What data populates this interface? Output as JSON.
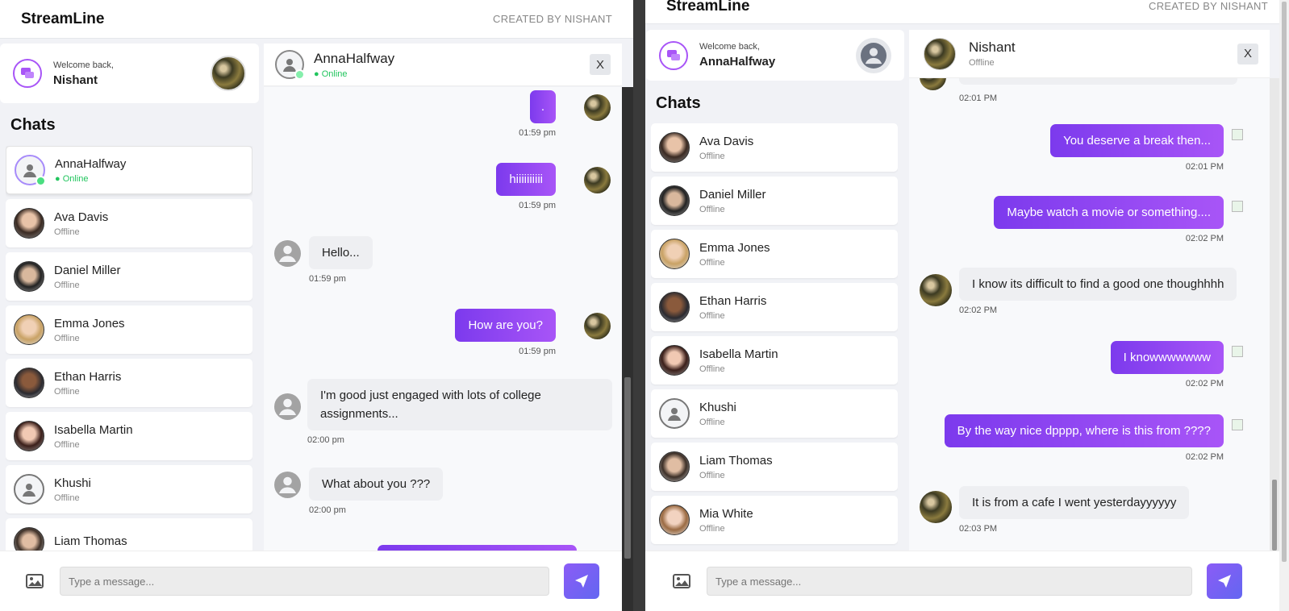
{
  "left": {
    "brand": "StreamLine",
    "credit": "CREATED BY NISHANT",
    "welcome": {
      "greeting": "Welcome back,",
      "name": "Nishant"
    },
    "chats_title": "Chats",
    "contacts": [
      {
        "name": "AnnaHalfway",
        "status": "● Online"
      },
      {
        "name": "Ava Davis",
        "status": "Offline"
      },
      {
        "name": "Daniel Miller",
        "status": "Offline"
      },
      {
        "name": "Emma Jones",
        "status": "Offline"
      },
      {
        "name": "Ethan Harris",
        "status": "Offline"
      },
      {
        "name": "Isabella Martin",
        "status": "Offline"
      },
      {
        "name": "Khushi",
        "status": "Offline"
      },
      {
        "name": "Liam Thomas",
        "status": ""
      }
    ],
    "header": {
      "name": "AnnaHalfway",
      "status": "● Online",
      "close": "X"
    },
    "messages": [
      {
        "text": ".",
        "time": "01:59 pm"
      },
      {
        "text": "hiiiiiiiiii",
        "time": "01:59 pm"
      },
      {
        "text": "Hello...",
        "time": "01:59 pm"
      },
      {
        "text": "How are you?",
        "time": "01:59 pm"
      },
      {
        "text": "I'm good just engaged with lots of college assignments...",
        "time": "02:00 pm"
      },
      {
        "text": "What about you ???",
        "time": "02:00 pm"
      }
    ],
    "input_placeholder": "Type a message..."
  },
  "right": {
    "brand": "StreamLine",
    "credit": "CREATED BY NISHANT",
    "welcome": {
      "greeting": "Welcome back,",
      "name": "AnnaHalfway"
    },
    "chats_title": "Chats",
    "contacts": [
      {
        "name": "Ava Davis",
        "status": "Offline"
      },
      {
        "name": "Daniel Miller",
        "status": "Offline"
      },
      {
        "name": "Emma Jones",
        "status": "Offline"
      },
      {
        "name": "Ethan Harris",
        "status": "Offline"
      },
      {
        "name": "Isabella Martin",
        "status": "Offline"
      },
      {
        "name": "Khushi",
        "status": "Offline"
      },
      {
        "name": "Liam Thomas",
        "status": "Offline"
      },
      {
        "name": "Mia White",
        "status": "Offline"
      }
    ],
    "header": {
      "name": "Nishant",
      "status": "Offline",
      "close": "X"
    },
    "messages": [
      {
        "text": "",
        "time": "02:01 PM"
      },
      {
        "text": "You deserve a break then...",
        "time": "02:01 PM"
      },
      {
        "text": "Maybe watch a movie or something....",
        "time": "02:02 PM"
      },
      {
        "text": "I know its difficult to find a good one thoughhhh",
        "time": "02:02 PM"
      },
      {
        "text": "I knowwwwwww",
        "time": "02:02 PM"
      },
      {
        "text": "By the way nice dpppp, where is this from ????",
        "time": "02:02 PM"
      },
      {
        "text": "It is from a cafe I went yesterdayyyyyy",
        "time": "02:03 PM"
      }
    ],
    "input_placeholder": "Type a message..."
  }
}
